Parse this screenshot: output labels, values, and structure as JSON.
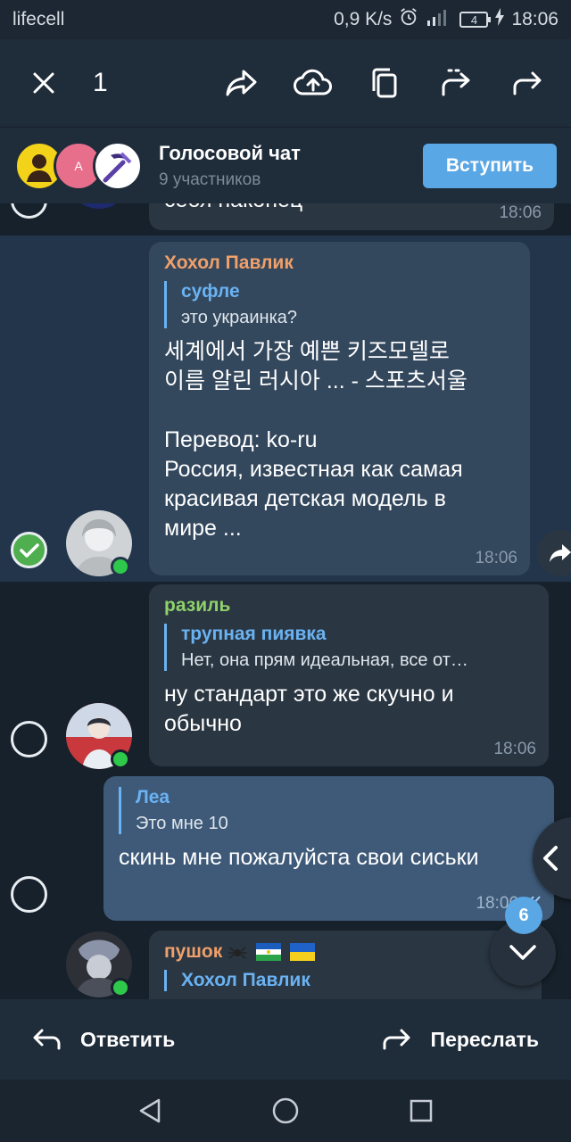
{
  "status": {
    "carrier": "lifecell",
    "speed": "0,9 K/s",
    "battery": "4",
    "time": "18:06"
  },
  "action_bar": {
    "selected_count": "1"
  },
  "voice_chat": {
    "title": "Голосовой чат",
    "participants": "9 участников",
    "join_label": "Вступить",
    "avatar_letter": "A"
  },
  "messages": [
    {
      "text": "себя наконец",
      "time": "18:06"
    },
    {
      "sender": "Хохол Павлик",
      "sender_color": "#f0a06a",
      "reply_name": "суфле",
      "reply_text": "это украинка?",
      "text": "세계에서 가장 예쁜 키즈모델로\n이름 알린 러시아 ... - 스포츠서울\n\nПеревод: ko-ru\nРоссия, известная как самая\nкрасивая детская модель в\nмире ...",
      "time": "18:06",
      "selected": true
    },
    {
      "sender": "разиль",
      "sender_color": "#8fd16a",
      "reply_name": "трупная пиявка",
      "reply_text": "Нет, она прям идеальная, все от…",
      "text": "ну стандарт это же скучно и\nобычно",
      "time": "18:06"
    },
    {
      "reply_name": "Леа",
      "reply_text": "Это мне 10",
      "text": "скинь мне пожалуйста свои сиськи",
      "time": "18:06",
      "outgoing": true
    },
    {
      "sender": "пушок",
      "sender_color": "#f0a06a",
      "reply_name": "Хохол Павлик"
    }
  ],
  "unread_badge": "6",
  "bottom_bar": {
    "reply_label": "Ответить",
    "forward_label": "Переслать"
  }
}
